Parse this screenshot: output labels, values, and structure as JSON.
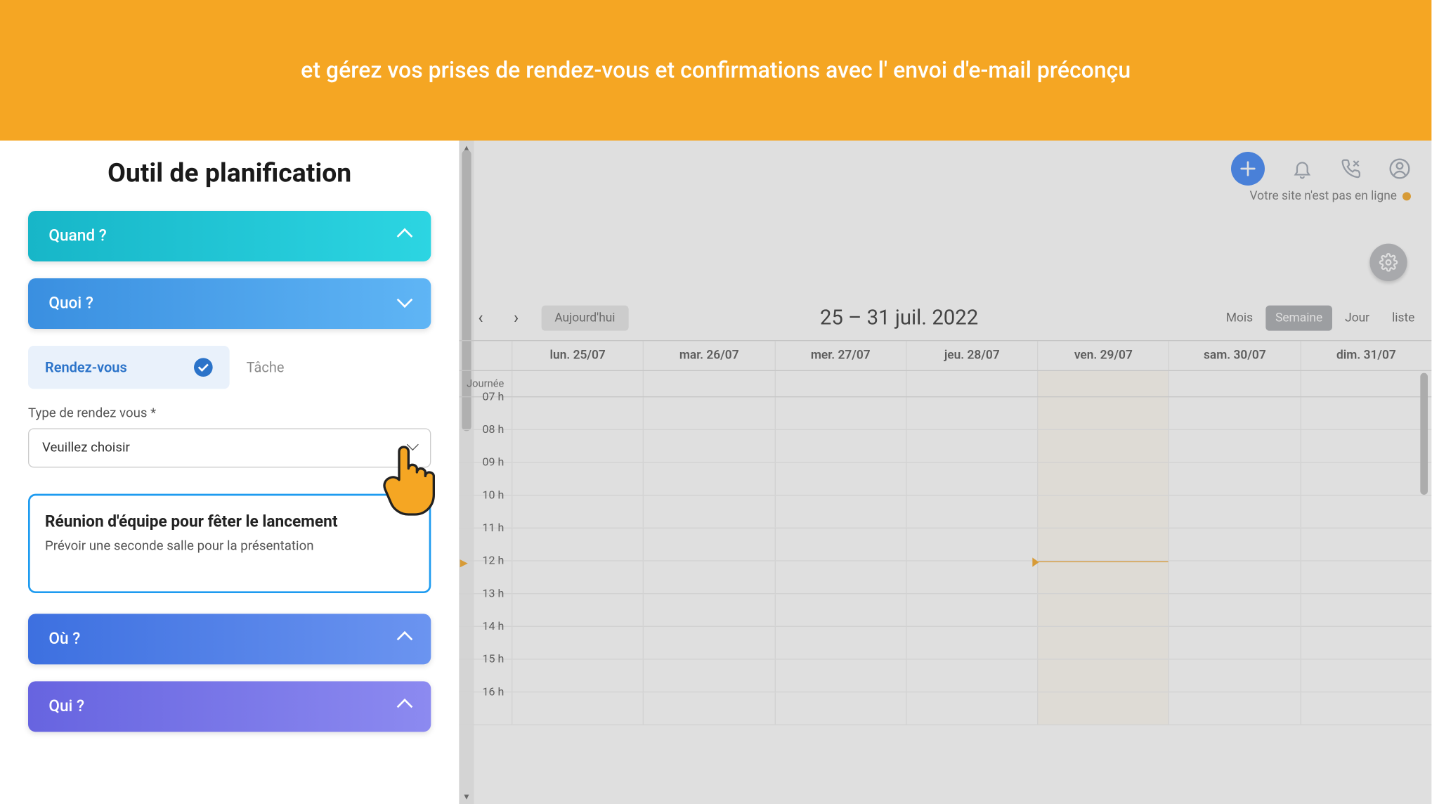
{
  "banner": "et gérez vos prises de rendez-vous et confirmations avec l' envoi d'e-mail préconçu",
  "panel": {
    "title": "Outil de planification",
    "sections": {
      "quand": "Quand ?",
      "quoi": "Quoi ?",
      "ou": "Où ?",
      "qui": "Qui ?"
    },
    "quoi_body": {
      "type_rdv": "Rendez-vous",
      "type_tache": "Tâche",
      "field_label": "Type de rendez vous *",
      "select_placeholder": "Veuillez choisir",
      "note_title": "Réunion d'équipe pour fêter le lancement",
      "note_body": "Prévoir une seconde salle pour la présentation"
    }
  },
  "topbar": {
    "site_status": "Votre site n'est pas en ligne"
  },
  "calendar": {
    "today_label": "Aujourd'hui",
    "date_range": "25 – 31 juil. 2022",
    "views": {
      "month": "Mois",
      "week": "Semaine",
      "day": "Jour",
      "list": "liste"
    },
    "allday_label": "Journée",
    "days": [
      "lun. 25/07",
      "mar. 26/07",
      "mer. 27/07",
      "jeu. 28/07",
      "ven. 29/07",
      "sam. 30/07",
      "dim. 31/07"
    ],
    "today_index": 4,
    "now_slot_index": 5,
    "hours": [
      "07 h",
      "08 h",
      "09 h",
      "10 h",
      "11 h",
      "12 h",
      "13 h",
      "14 h",
      "15 h",
      "16 h"
    ]
  }
}
